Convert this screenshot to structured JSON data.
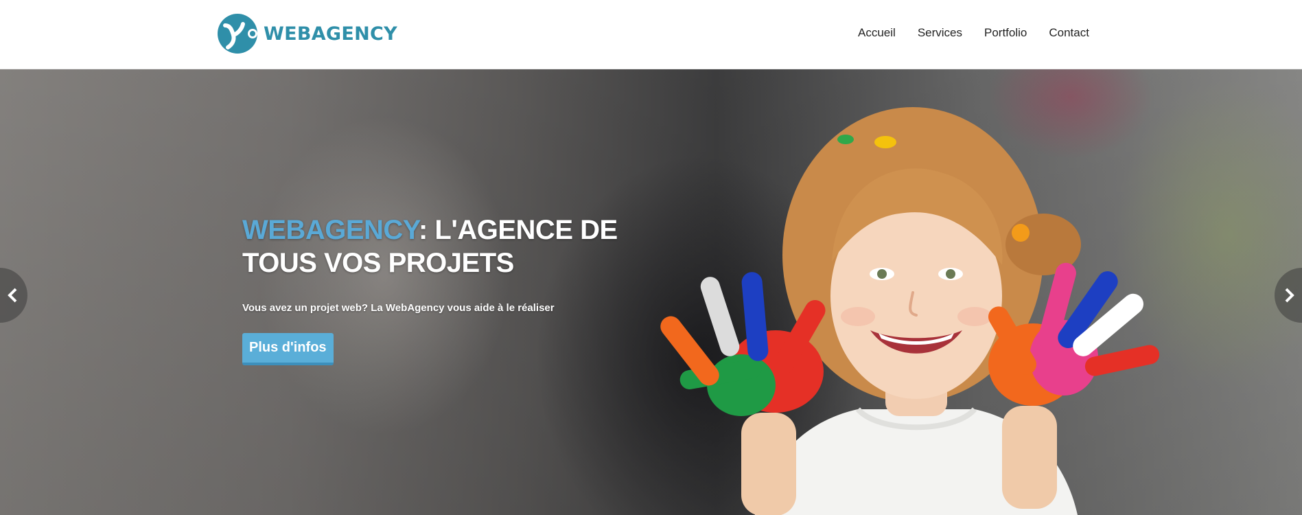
{
  "header": {
    "logo_text": "WEBAGENCY",
    "nav": [
      {
        "label": "Accueil"
      },
      {
        "label": "Services"
      },
      {
        "label": "Portfolio"
      },
      {
        "label": "Contact"
      }
    ]
  },
  "hero": {
    "title_brand": "WEBAGENCY",
    "title_rest": ": L'AGENCE DE TOUS VOS PROJETS",
    "subtitle": "Vous avez un projet web? La WebAgency vous aide à le réaliser",
    "button_label": "Plus d'infos",
    "image_icon": "child-painted-hands-photo",
    "prev_icon": "chevron-left-icon",
    "next_icon": "chevron-right-icon"
  },
  "colors": {
    "brand_teal": "#2f8fa9",
    "brand_blue": "#5aa9d6",
    "button_bg": "#5aaed8",
    "button_border": "#3d8fbb"
  }
}
